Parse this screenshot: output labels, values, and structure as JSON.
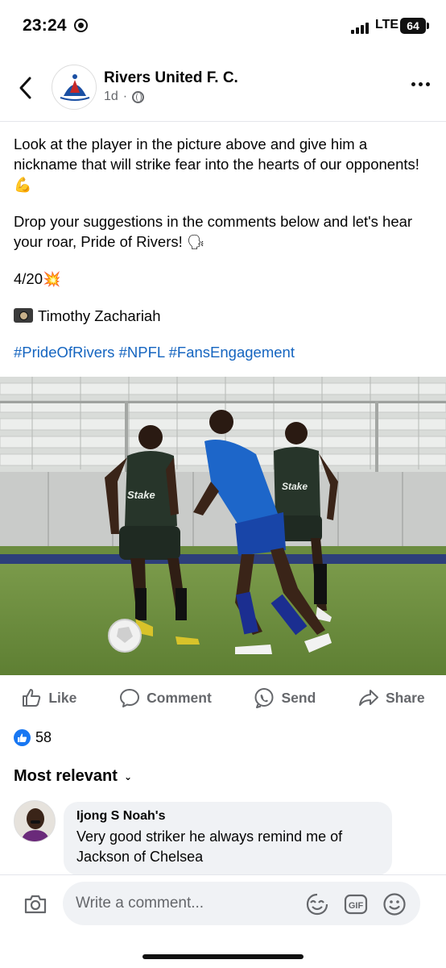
{
  "status_bar": {
    "time": "23:24",
    "network": "LTE",
    "battery": "64"
  },
  "post": {
    "page_name": "Rivers United F. C.",
    "time_ago": "1d",
    "time_sep": "·",
    "text_line1": "Look at the player in the picture above and give him a nickname that will strike fear into the hearts of our opponents! ",
    "emoji1": "💪",
    "text_line2": "Drop your suggestions in the comments below and let's hear your roar, Pride of Rivers! ",
    "emoji2": "🗣",
    "counter": "4/20",
    "emoji3": "💥",
    "photo_credit": "Timothy Zachariah",
    "hashtags": [
      "#PrideOfRivers",
      "#NPFL",
      "#FansEngagement"
    ],
    "photo_jersey_text_1": "Stake",
    "photo_jersey_text_2": "Stake"
  },
  "actions": {
    "like": "Like",
    "comment": "Comment",
    "send": "Send",
    "share": "Share"
  },
  "reactions": {
    "count": "58"
  },
  "comments_sort": {
    "label": "Most relevant"
  },
  "comments": [
    {
      "author": "Ijong S Noah's",
      "text": "Very good striker he always remind me of Jackson of Chelsea"
    }
  ],
  "composer": {
    "placeholder": "Write a comment..."
  },
  "colors": {
    "link": "#1565c0",
    "like_blue": "#1877f2",
    "muted": "#65676b",
    "bubble": "#f0f2f5"
  },
  "icons": [
    "back-arrow-icon",
    "globe-icon",
    "more-options-icon",
    "like-icon",
    "comment-icon",
    "send-icon",
    "share-icon",
    "like-reaction-icon",
    "camera-icon",
    "sticker-icon",
    "gif-icon",
    "emoji-icon"
  ]
}
